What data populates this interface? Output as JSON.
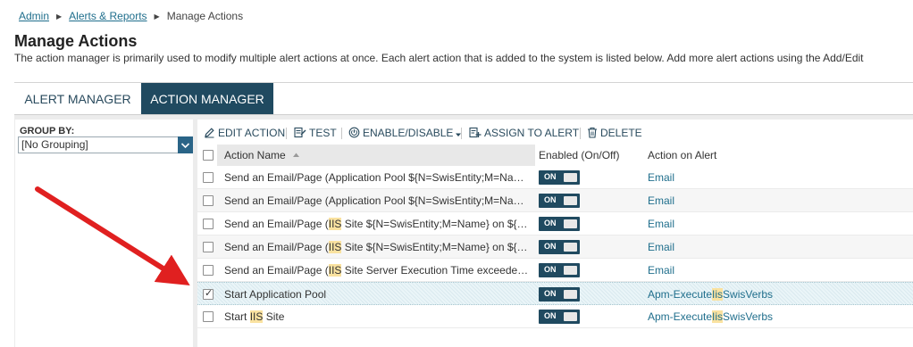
{
  "breadcrumb": {
    "items": [
      "Admin",
      "Alerts & Reports"
    ],
    "current": "Manage Actions"
  },
  "page": {
    "title": "Manage Actions",
    "description": "The action manager is primarily used to modify multiple alert actions at once. Each alert action that is added to the system is listed below. Add more alert actions using the Add/Edit"
  },
  "tabs": [
    {
      "label": "ALERT MANAGER",
      "active": false
    },
    {
      "label": "ACTION MANAGER",
      "active": true
    }
  ],
  "group_by": {
    "label": "GROUP BY:",
    "value": "[No Grouping]"
  },
  "toolbar": {
    "edit_action": "EDIT ACTION",
    "test": "TEST",
    "enable_disable": "ENABLE/DISABLE",
    "assign_to_alert": "ASSIGN TO ALERT",
    "delete": "DELETE"
  },
  "table": {
    "columns": {
      "name": "Action Name",
      "enabled": "Enabled (On/Off)",
      "action_on_alert": "Action on Alert"
    },
    "toggle_label": "ON",
    "rows": [
      {
        "name_parts": [
          "Send an Email/Page (Application Pool ${N=SwisEntity;M=Na…"
        ],
        "alert_parts": [
          "Email"
        ],
        "enabled": true,
        "checked": false
      },
      {
        "name_parts": [
          "Send an Email/Page (Application Pool ${N=SwisEntity;M=Na…"
        ],
        "alert_parts": [
          "Email"
        ],
        "enabled": true,
        "checked": false
      },
      {
        "name_parts": [
          "Send an Email/Page (",
          "IIS",
          " Site ${N=SwisEntity;M=Name} on ${…"
        ],
        "alert_parts": [
          "Email"
        ],
        "enabled": true,
        "checked": false
      },
      {
        "name_parts": [
          "Send an Email/Page (",
          "IIS",
          " Site ${N=SwisEntity;M=Name} on ${…"
        ],
        "alert_parts": [
          "Email"
        ],
        "enabled": true,
        "checked": false
      },
      {
        "name_parts": [
          "Send an Email/Page (",
          "IIS",
          " Site Server Execution Time exceede…"
        ],
        "alert_parts": [
          "Email"
        ],
        "enabled": true,
        "checked": false
      },
      {
        "name_parts": [
          "Start Application Pool"
        ],
        "alert_parts": [
          "Apm-Execute",
          "Iis",
          "SwisVerbs"
        ],
        "enabled": true,
        "checked": true
      },
      {
        "name_parts": [
          "Start ",
          "IIS",
          " Site"
        ],
        "alert_parts": [
          "Apm-Execute",
          "Iis",
          "SwisVerbs"
        ],
        "enabled": true,
        "checked": false
      }
    ]
  },
  "colors": {
    "accent": "#204a60",
    "link": "#1f6e8c",
    "highlight": "#fae2a0",
    "arrow": "#e02020"
  }
}
